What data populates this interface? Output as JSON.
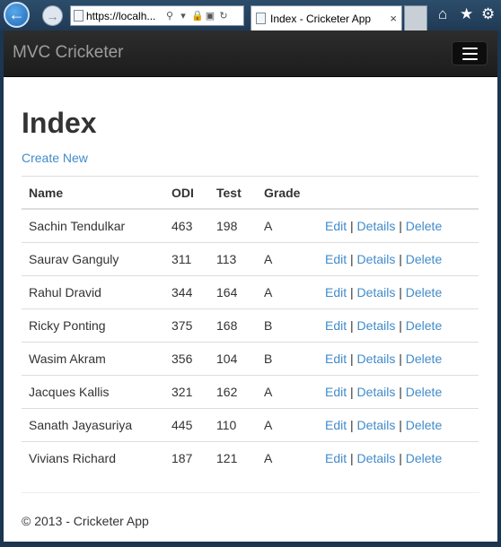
{
  "browser": {
    "url": "https://localh...",
    "tab_title": "Index - Cricketer App",
    "tab_close": "×",
    "icons": [
      "back-arrow-icon",
      "forward-arrow-icon",
      "search-icon",
      "lock-icon",
      "refresh-icon",
      "home-icon",
      "favorites-star-icon",
      "settings-gear-icon"
    ]
  },
  "app": {
    "brand": "MVC Cricketer"
  },
  "page": {
    "title": "Index",
    "create_link": "Create New",
    "columns": [
      "Name",
      "ODI",
      "Test",
      "Grade"
    ],
    "actions": {
      "edit": "Edit",
      "details": "Details",
      "delete": "Delete",
      "separator": "|"
    },
    "rows": [
      {
        "name": "Sachin Tendulkar",
        "odi": "463",
        "test": "198",
        "grade": "A"
      },
      {
        "name": "Saurav Ganguly",
        "odi": "311",
        "test": "113",
        "grade": "A"
      },
      {
        "name": "Rahul Dravid",
        "odi": "344",
        "test": "164",
        "grade": "A"
      },
      {
        "name": "Ricky Ponting",
        "odi": "375",
        "test": "168",
        "grade": "B"
      },
      {
        "name": "Wasim Akram",
        "odi": "356",
        "test": "104",
        "grade": "B"
      },
      {
        "name": "Jacques Kallis",
        "odi": "321",
        "test": "162",
        "grade": "A"
      },
      {
        "name": "Sanath Jayasuriya",
        "odi": "445",
        "test": "110",
        "grade": "A"
      },
      {
        "name": "Vivians Richard",
        "odi": "187",
        "test": "121",
        "grade": "A"
      }
    ]
  },
  "footer": {
    "text": "© 2013 - Cricketer App"
  },
  "colors": {
    "link": "#428bca",
    "navbar": "#222222",
    "brand_text": "#9d9d9d"
  }
}
